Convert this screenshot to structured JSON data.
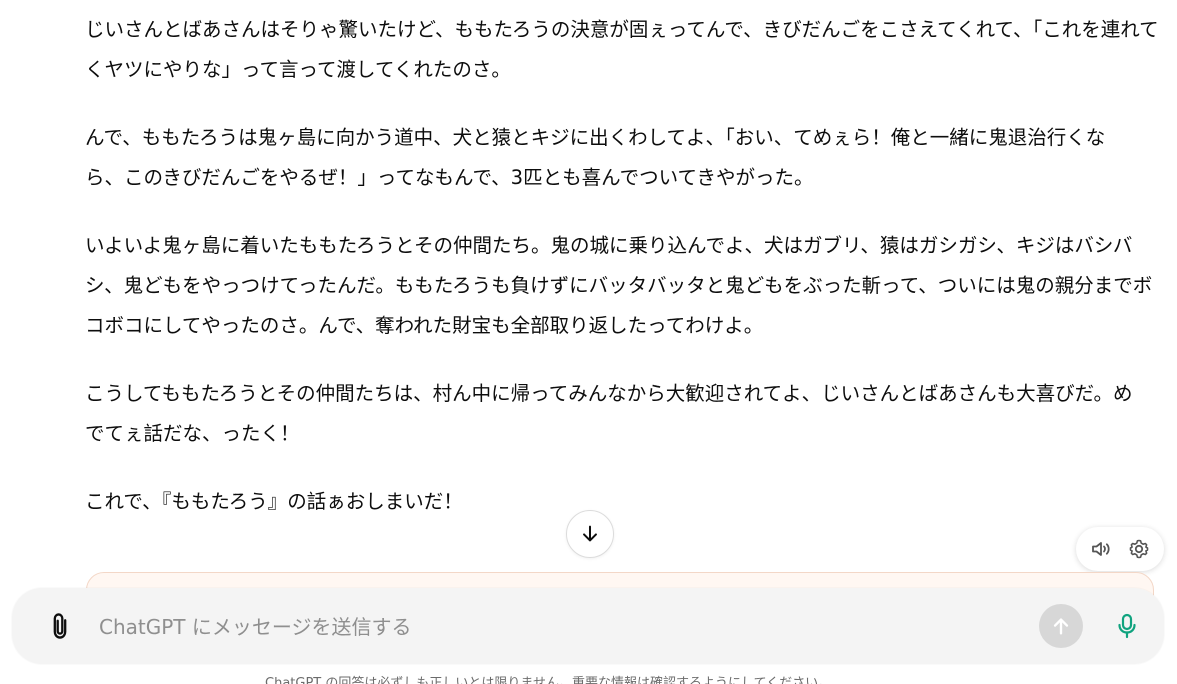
{
  "message": {
    "paragraphs": [
      "じいさんとばあさんはそりゃ驚いたけど、ももたろうの決意が固ぇってんで、きびだんごをこさえてくれて、「これを連れてくヤツにやりな」って言って渡してくれたのさ。",
      "んで、ももたろうは鬼ヶ島に向かう道中、犬と猿とキジに出くわしてよ、「おい、てめぇら！俺と一緒に鬼退治行くなら、このきびだんごをやるぜ！」ってなもんで、3匹とも喜んでついてきやがった。",
      "いよいよ鬼ヶ島に着いたももたろうとその仲間たち。鬼の城に乗り込んでよ、犬はガブリ、猿はガシガシ、キジはバシバシ、鬼どもをやっつけてったんだ。ももたろうも負けずにバッタバッタと鬼どもをぶった斬って、ついには鬼の親分までボコボコにしてやったのさ。んで、奪われた財宝も全部取り返したってわけよ。",
      "こうしてももたろうとその仲間たちは、村ん中に帰ってみんなから大歓迎されてよ、じいさんとばあさんも大喜びだ。めでてぇ話だな、ったく！",
      "これで、『ももたろう』の話ぁおしまいだ！"
    ]
  },
  "controls": {
    "scroll_down_icon": "arrow-down-icon",
    "read_aloud_icon": "speaker-icon",
    "settings_icon": "gear-icon"
  },
  "composer": {
    "placeholder": "ChatGPT にメッセージを送信する",
    "value": "",
    "attach_icon": "paperclip-icon",
    "send_icon": "arrow-up-icon",
    "mic_icon": "microphone-icon"
  },
  "footer": {
    "disclaimer": "ChatGPT の回答は必ずしも正しいとは限りません。重要な情報は確認するようにしてください。"
  },
  "colors": {
    "mic_accent": "#10a37f",
    "send_disabled": "#d7d7d7",
    "composer_bg": "#f4f4f4",
    "notice_border": "#f3d7c7"
  }
}
